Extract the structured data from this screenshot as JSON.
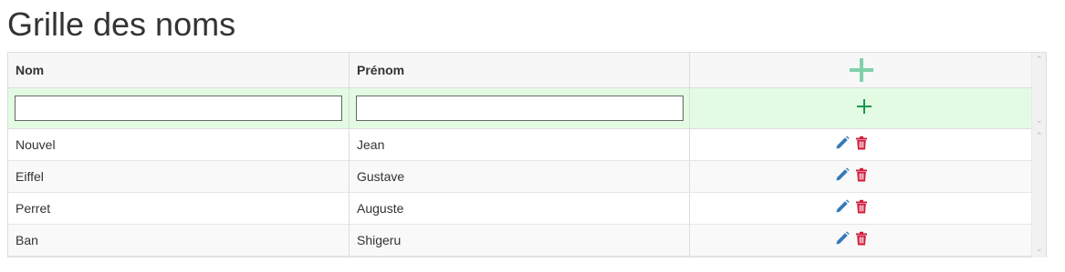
{
  "page": {
    "title": "Grille des noms"
  },
  "grid": {
    "columns": {
      "nom": "Nom",
      "prenom": "Prénom"
    },
    "add_row": {
      "nom_value": "",
      "prenom_value": ""
    },
    "rows": [
      {
        "nom": "Nouvel",
        "prenom": "Jean"
      },
      {
        "nom": "Eiffel",
        "prenom": "Gustave"
      },
      {
        "nom": "Perret",
        "prenom": "Auguste"
      },
      {
        "nom": "Ban",
        "prenom": "Shigeru"
      }
    ]
  },
  "icons": {
    "header_add": "plus-icon",
    "row_add": "plus-icon",
    "edit": "pencil-icon",
    "delete": "trash-icon"
  },
  "colors": {
    "add_row_bg": "#e3fbe3",
    "header_plus": "#7fd1ac",
    "add_plus": "#0f9a4a",
    "edit_icon": "#337ab7",
    "delete_icon": "#d01c3c"
  }
}
